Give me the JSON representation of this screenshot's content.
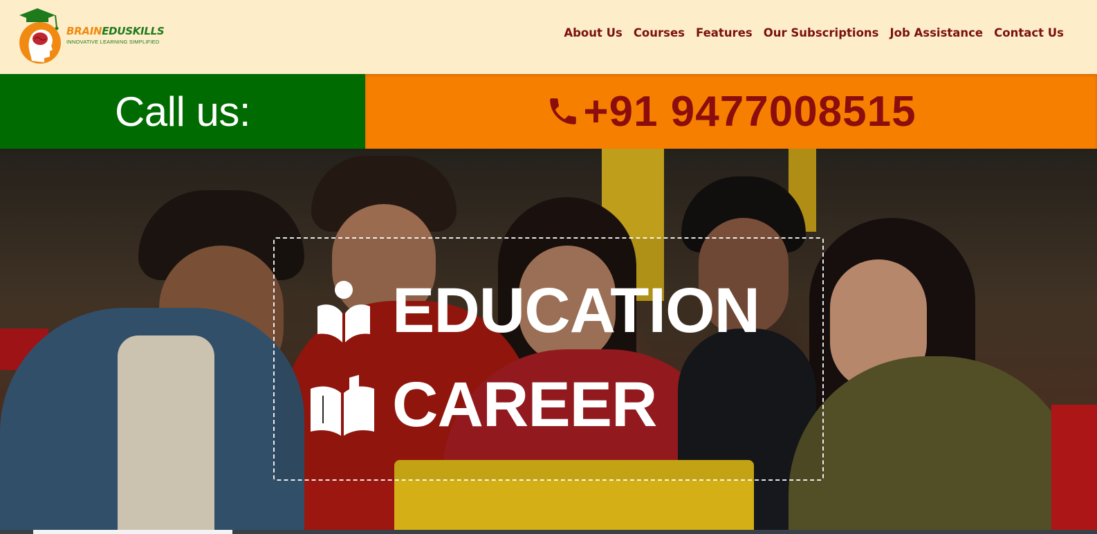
{
  "brand": {
    "name_part1": "BRAIN",
    "name_part2": "EDUSKILLS",
    "tagline": "INNOVATIVE LEARNING SIMPLIFIED"
  },
  "nav": {
    "items": [
      {
        "label": "About Us"
      },
      {
        "label": "Courses"
      },
      {
        "label": "Features"
      },
      {
        "label": "Our Subscriptions"
      },
      {
        "label": "Job Assistance"
      },
      {
        "label": "Contact Us"
      }
    ]
  },
  "callbar": {
    "label": "Call us:",
    "phone": "+91 9477008515",
    "icon": "phone-icon"
  },
  "hero": {
    "line1": {
      "icon": "reader-icon",
      "text": "EDUCATION"
    },
    "line2": {
      "icon": "open-book-icon",
      "text": "CAREER"
    }
  },
  "colors": {
    "header_bg": "#fdedc9",
    "nav_text": "#7a1010",
    "call_left_bg": "#006b00",
    "call_right_bg": "#f77f00",
    "phone_text": "#8b0d0d",
    "brand_orange": "#f08a12",
    "brand_green": "#1f7a1c"
  }
}
